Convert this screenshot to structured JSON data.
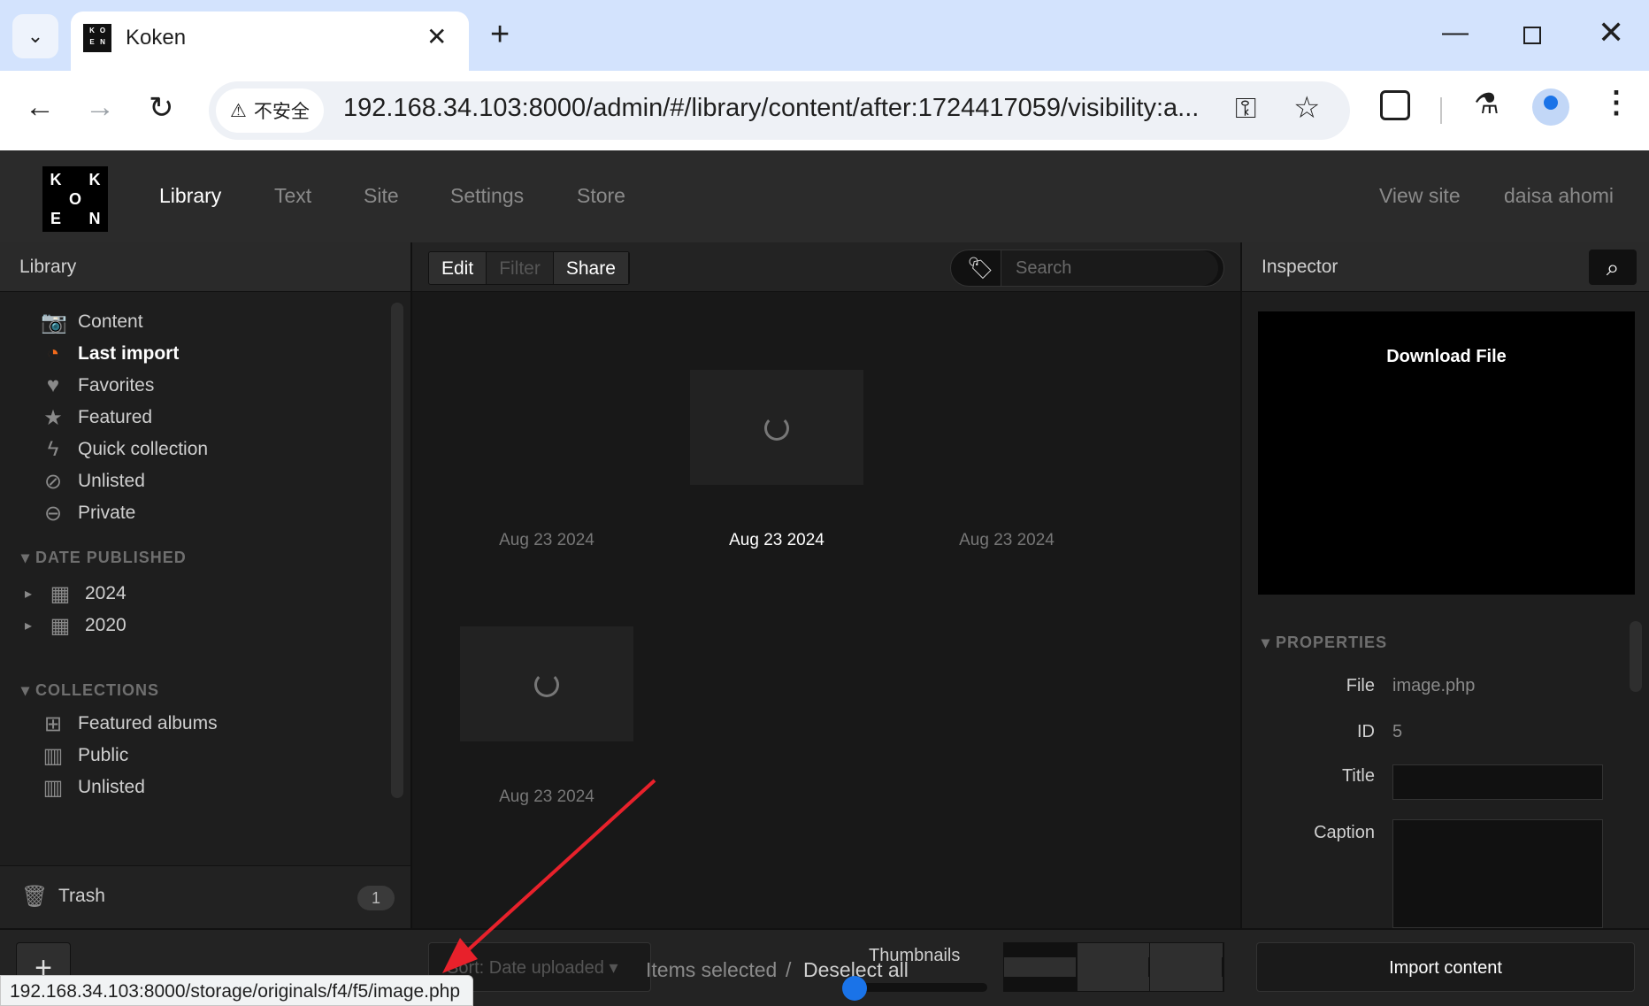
{
  "browser": {
    "tab_title": "Koken",
    "tab_close": "✕",
    "new_tab": "+",
    "security_label": "不安全",
    "url": "192.168.34.103:8000/admin/#/library/content/after:1724417059/visibility:a...",
    "status_url": "192.168.34.103:8000/storage/originals/f4/f5/image.php"
  },
  "logo": [
    "K",
    "",
    "K",
    "",
    "O",
    "",
    "E",
    "",
    "N"
  ],
  "favicon": [
    "K",
    "O",
    "E",
    "N"
  ],
  "mainnav": {
    "library": "Library",
    "text": "Text",
    "site": "Site",
    "settings": "Settings",
    "store": "Store",
    "view_site": "View site",
    "user": "daisa ahomi"
  },
  "left": {
    "title": "Library",
    "items": [
      {
        "label": "Content",
        "icon": "camera-icon"
      },
      {
        "label": "Last import",
        "icon": "clock-icon"
      },
      {
        "label": "Favorites",
        "icon": "heart-icon"
      },
      {
        "label": "Featured",
        "icon": "star-icon"
      },
      {
        "label": "Quick collection",
        "icon": "bolt-icon"
      },
      {
        "label": "Unlisted",
        "icon": "eye-slash-icon"
      },
      {
        "label": "Private",
        "icon": "minus-circle-icon"
      }
    ],
    "date_published": "DATE PUBLISHED",
    "years": [
      "2024",
      "2020"
    ],
    "collections": "COLLECTIONS",
    "collection_items": [
      "Featured albums",
      "Public",
      "Unlisted"
    ],
    "trash": "Trash",
    "trash_count": "1"
  },
  "center": {
    "edit": "Edit",
    "filter": "Filter",
    "share": "Share",
    "search_placeholder": "Search",
    "items": [
      {
        "date": "Aug 23 2024"
      },
      {
        "date": "Aug 23 2024"
      },
      {
        "date": "Aug 23 2024"
      },
      {
        "date": "Aug 23 2024"
      }
    ]
  },
  "inspector": {
    "title": "Inspector",
    "preview_title": "Download File",
    "properties": "PROPERTIES",
    "file_label": "File",
    "file_value": "image.php",
    "id_label": "ID",
    "id_value": "5",
    "title_label": "Title",
    "caption_label": "Caption"
  },
  "bottom": {
    "sort": "Sort: Date uploaded",
    "selected": "Items selected",
    "separator": "/",
    "deselect": "Deselect all",
    "thumbnails": "Thumbnails",
    "import": "Import content"
  },
  "colors": {
    "accent": "#f26a1b",
    "link": "#1a73e8"
  }
}
